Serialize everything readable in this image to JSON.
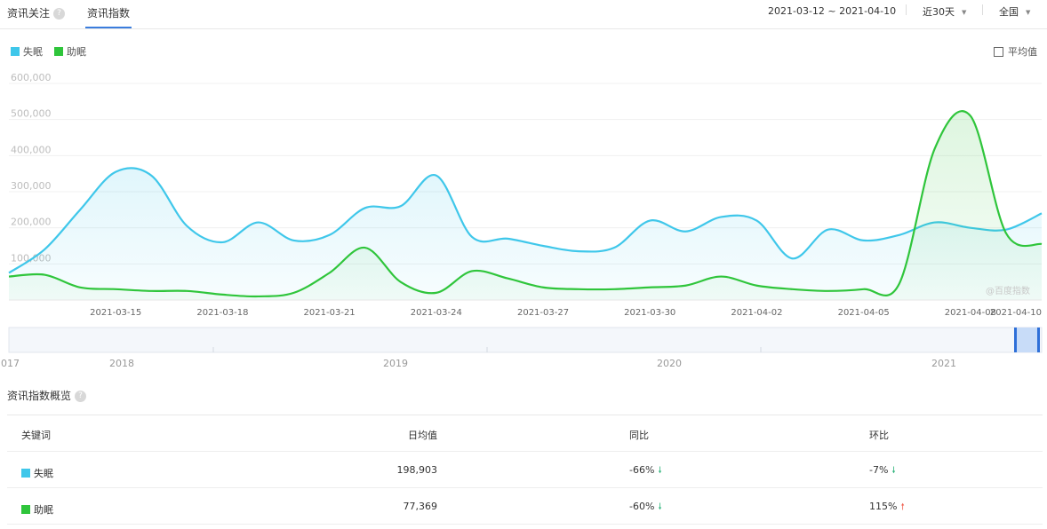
{
  "tabs": [
    {
      "label": "资讯关注",
      "active": false
    },
    {
      "label": "资讯指数",
      "active": true
    }
  ],
  "filters": {
    "date_range": "2021-03-12 ~ 2021-04-10",
    "period": "近30天",
    "region": "全国"
  },
  "legend": [
    {
      "name": "失眠",
      "color": "#3fc7ea"
    },
    {
      "name": "助眠",
      "color": "#2fc53b"
    }
  ],
  "average_toggle": {
    "label": "平均值",
    "checked": false
  },
  "watermark": "@百度指数",
  "chart_data": {
    "type": "area",
    "x": [
      "2021-03-12",
      "2021-03-13",
      "2021-03-14",
      "2021-03-15",
      "2021-03-16",
      "2021-03-17",
      "2021-03-18",
      "2021-03-19",
      "2021-03-20",
      "2021-03-21",
      "2021-03-22",
      "2021-03-23",
      "2021-03-24",
      "2021-03-25",
      "2021-03-26",
      "2021-03-27",
      "2021-03-28",
      "2021-03-29",
      "2021-03-30",
      "2021-03-31",
      "2021-04-01",
      "2021-04-02",
      "2021-04-03",
      "2021-04-04",
      "2021-04-05",
      "2021-04-06",
      "2021-04-07",
      "2021-04-08",
      "2021-04-09",
      "2021-04-10"
    ],
    "x_tick_labels": [
      "2021-03-15",
      "2021-03-18",
      "2021-03-21",
      "2021-03-24",
      "2021-03-27",
      "2021-03-30",
      "2021-04-02",
      "2021-04-05",
      "2021-04-08",
      "2021-04-10"
    ],
    "y_ticks": [
      "100,000",
      "200,000",
      "300,000",
      "400,000",
      "500,000",
      "600,000"
    ],
    "ylim": [
      0,
      600000
    ],
    "grid": true,
    "series": [
      {
        "name": "失眠",
        "color": "#3fc7ea",
        "values": [
          75000,
          140000,
          250000,
          355000,
          345000,
          205000,
          160000,
          215000,
          165000,
          180000,
          255000,
          260000,
          345000,
          175000,
          170000,
          150000,
          135000,
          145000,
          220000,
          190000,
          230000,
          220000,
          115000,
          195000,
          165000,
          180000,
          215000,
          200000,
          195000,
          240000
        ]
      },
      {
        "name": "助眠",
        "color": "#2fc53b",
        "values": [
          65000,
          70000,
          35000,
          30000,
          25000,
          25000,
          15000,
          10000,
          20000,
          75000,
          145000,
          50000,
          20000,
          80000,
          60000,
          35000,
          30000,
          30000,
          35000,
          40000,
          65000,
          40000,
          30000,
          25000,
          30000,
          45000,
          420000,
          510000,
          185000,
          155000
        ]
      }
    ]
  },
  "timeline": {
    "year_labels": [
      "2017",
      "2018",
      "2019",
      "2020",
      "2021"
    ]
  },
  "overview": {
    "title": "资讯指数概览",
    "headers": {
      "keyword": "关键词",
      "daily_avg": "日均值",
      "yoy": "同比",
      "mom": "环比"
    },
    "rows": [
      {
        "keyword": "失眠",
        "color": "#3fc7ea",
        "daily_avg": "198,903",
        "yoy": "-66%",
        "yoy_dir": "down",
        "mom": "-7%",
        "mom_dir": "down"
      },
      {
        "keyword": "助眠",
        "color": "#2fc53b",
        "daily_avg": "77,369",
        "yoy": "-60%",
        "yoy_dir": "down",
        "mom": "115%",
        "mom_dir": "up"
      }
    ]
  }
}
